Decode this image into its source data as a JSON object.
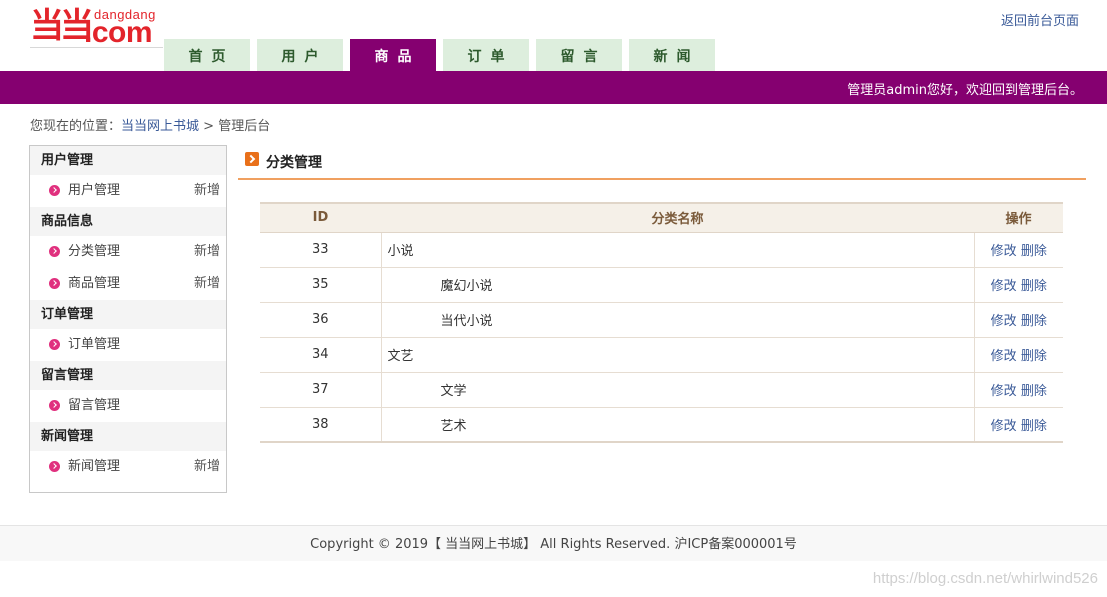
{
  "header": {
    "logo_cn": "当当",
    "logo_en": "dangdang",
    "logo_com": ".com",
    "back_link": "返回前台页面",
    "welcome": "管理员admin您好，欢迎回到管理后台。"
  },
  "nav": {
    "tabs": [
      {
        "label": "首页",
        "active": false
      },
      {
        "label": "用户",
        "active": false
      },
      {
        "label": "商品",
        "active": true
      },
      {
        "label": "订单",
        "active": false
      },
      {
        "label": "留言",
        "active": false
      },
      {
        "label": "新闻",
        "active": false
      }
    ]
  },
  "breadcrumb": {
    "prefix": "您现在的位置：",
    "home": "当当网上书城",
    "sep": ">",
    "current": "管理后台"
  },
  "sidebar": {
    "sections": [
      {
        "title": "用户管理",
        "items": [
          {
            "label": "用户管理",
            "add": "新增"
          }
        ]
      },
      {
        "title": "商品信息",
        "items": [
          {
            "label": "分类管理",
            "add": "新增"
          },
          {
            "label": "商品管理",
            "add": "新增"
          }
        ]
      },
      {
        "title": "订单管理",
        "items": [
          {
            "label": "订单管理",
            "add": ""
          }
        ]
      },
      {
        "title": "留言管理",
        "items": [
          {
            "label": "留言管理",
            "add": ""
          }
        ]
      },
      {
        "title": "新闻管理",
        "items": [
          {
            "label": "新闻管理",
            "add": "新增"
          }
        ]
      }
    ]
  },
  "main": {
    "title": "分类管理",
    "columns": {
      "id": "ID",
      "name": "分类名称",
      "ops": "操作"
    },
    "rows": [
      {
        "id": "33",
        "name": "小说",
        "level": 0,
        "edit": "修改",
        "delete": "删除"
      },
      {
        "id": "35",
        "name": "魔幻小说",
        "level": 1,
        "edit": "修改",
        "delete": "删除"
      },
      {
        "id": "36",
        "name": "当代小说",
        "level": 1,
        "edit": "修改",
        "delete": "删除"
      },
      {
        "id": "34",
        "name": "文艺",
        "level": 0,
        "edit": "修改",
        "delete": "删除"
      },
      {
        "id": "37",
        "name": "文学",
        "level": 1,
        "edit": "修改",
        "delete": "删除"
      },
      {
        "id": "38",
        "name": "艺术",
        "level": 1,
        "edit": "修改",
        "delete": "删除"
      }
    ]
  },
  "footer": {
    "text": "Copyright © 2019【 当当网上书城】 All Rights Reserved. 沪ICP备案000001号"
  },
  "watermark": "https://blog.csdn.net/whirlwind526",
  "colors": {
    "brand_red": "#e3242b",
    "purple": "#850070",
    "tab_bg": "#ddeedd",
    "accent_orange": "#f0a060",
    "link_blue": "#3a5a98"
  }
}
